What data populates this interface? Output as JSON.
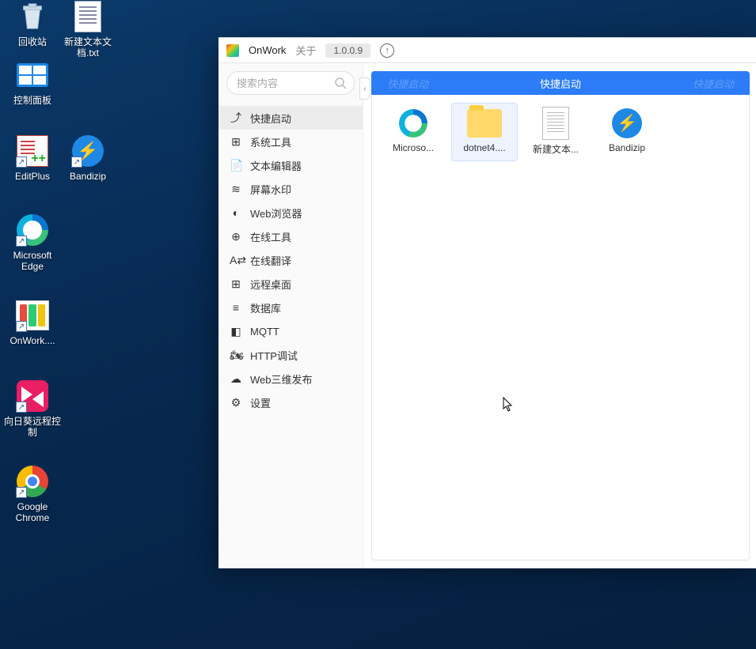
{
  "desktop": {
    "icons": [
      {
        "label": "回收站"
      },
      {
        "label": "新建文本文\n档.txt"
      },
      {
        "label": "控制面板"
      },
      {
        "label": "EditPlus"
      },
      {
        "label": "Bandizip"
      },
      {
        "label": "Microsoft\nEdge"
      },
      {
        "label": "OnWork...."
      },
      {
        "label": "向日葵远程控\n制"
      },
      {
        "label": "Google\nChrome"
      }
    ]
  },
  "window": {
    "title": "OnWork",
    "about": "关于",
    "version": "1.0.0.9",
    "search_placeholder": "搜索内容",
    "sidebar": {
      "items": [
        {
          "label": "快捷启动",
          "icon": "⤴"
        },
        {
          "label": "系统工具",
          "icon": "⊞"
        },
        {
          "label": "文本编辑器",
          "icon": "📄"
        },
        {
          "label": "屏幕水印",
          "icon": "≋"
        },
        {
          "label": "Web浏览器",
          "icon": "◐"
        },
        {
          "label": "在线工具",
          "icon": "⊕"
        },
        {
          "label": "在线翻译",
          "icon": "A⇄"
        },
        {
          "label": "远程桌面",
          "icon": "⊞"
        },
        {
          "label": "数据库",
          "icon": "≡"
        },
        {
          "label": "MQTT",
          "icon": "◧"
        },
        {
          "label": "HTTP调试",
          "icon": "🏍"
        },
        {
          "label": "Web三维发布",
          "icon": "☁"
        },
        {
          "label": "设置",
          "icon": "⚙"
        }
      ],
      "active": 0
    },
    "tab_title": "快捷启动",
    "tiles": [
      {
        "label": "Microso..."
      },
      {
        "label": "dotnet4...."
      },
      {
        "label": "新建文本..."
      },
      {
        "label": "Bandizip"
      }
    ],
    "selected_tile": 1
  }
}
